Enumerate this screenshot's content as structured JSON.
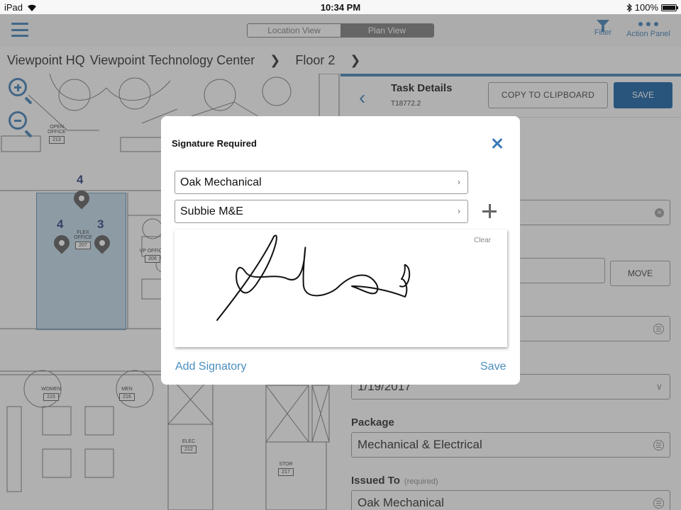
{
  "status_bar": {
    "device": "iPad",
    "time": "10:34 PM",
    "battery": "100%"
  },
  "nav": {
    "segment": [
      "Location View",
      "Plan View"
    ],
    "filter_label": "Filter",
    "action_panel_label": "Action Panel"
  },
  "breadcrumb": [
    "Viewpoint HQ",
    "Viewpoint Technology Center",
    "Floor 2"
  ],
  "plan": {
    "rooms": [
      {
        "name": "OPEN OFFICE",
        "number": "213"
      },
      {
        "name": "FLEX OFFICE",
        "number": "207"
      },
      {
        "name": "VP OFFICE",
        "number": "206"
      },
      {
        "name": "WOMEN",
        "number": "215"
      },
      {
        "name": "MEN",
        "number": "216"
      },
      {
        "name": "ELEC",
        "number": "212"
      },
      {
        "name": "STOR",
        "number": "217"
      }
    ],
    "pins": [
      "4",
      "4",
      "3"
    ]
  },
  "task": {
    "title": "Task Details",
    "id": "T18772.2",
    "copy_label": "COPY TO CLIPBOARD",
    "save_label": "SAVE",
    "move_label": "MOVE",
    "date_value": "1/19/2017",
    "package_label": "Package",
    "package_value": "Mechanical & Electrical",
    "issued_to_label": "Issued To",
    "issued_to_required": "(required)",
    "issued_to_value": "Oak Mechanical"
  },
  "modal": {
    "title": "Signature Required",
    "company": "Oak Mechanical",
    "signatory": "Subbie M&E",
    "clear_label": "Clear",
    "add_signatory_label": "Add Signatory",
    "save_label": "Save"
  },
  "colors": {
    "accent": "#3a7ab5",
    "primary_button": "#0a5aa3",
    "link": "#4a8ec0"
  }
}
